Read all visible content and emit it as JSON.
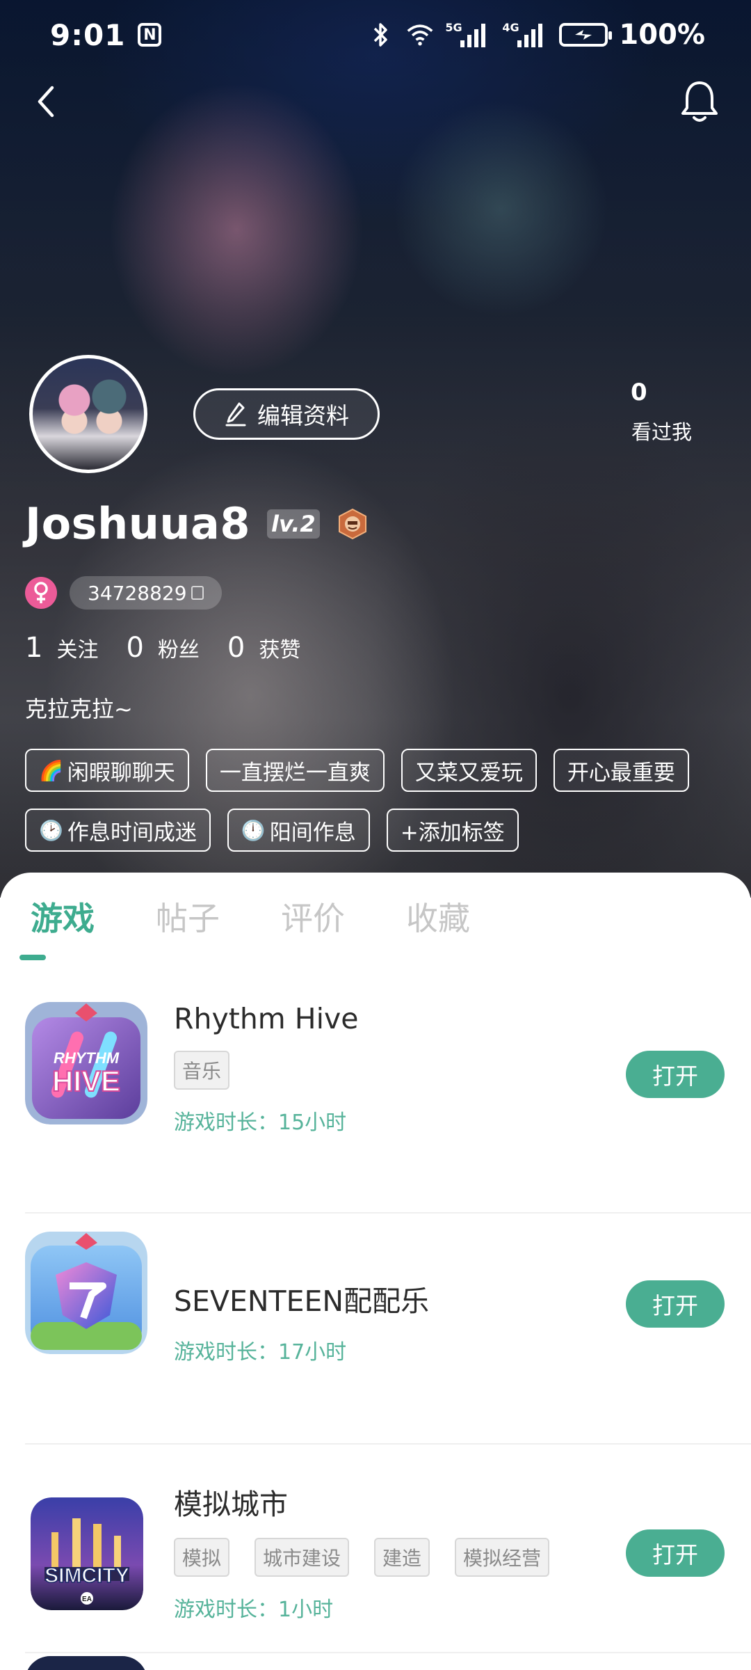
{
  "status_bar": {
    "time": "9:01",
    "nfc_label": "N",
    "network_5g": "5G",
    "network_4g": "4G",
    "battery_percent": "100%"
  },
  "profile": {
    "edit_label": "编辑资料",
    "viewers_count": "0",
    "viewers_label": "看过我",
    "username": "Joshuua8",
    "level": "lv.2",
    "user_id": "34728829",
    "stats": [
      {
        "value": "1",
        "label": "关注"
      },
      {
        "value": "0",
        "label": "粉丝"
      },
      {
        "value": "0",
        "label": "获赞"
      }
    ],
    "bio": "克拉克拉~",
    "tags": [
      {
        "emoji": "🌈",
        "text": "闲暇聊聊天"
      },
      {
        "emoji": "",
        "text": "一直摆烂一直爽"
      },
      {
        "emoji": "",
        "text": "又菜又爱玩"
      },
      {
        "emoji": "",
        "text": "开心最重要"
      },
      {
        "emoji": "🕑",
        "text": "作息时间成迷"
      },
      {
        "emoji": "🕛",
        "text": "阳间作息"
      },
      {
        "emoji": "",
        "text": "+添加标签"
      }
    ]
  },
  "tabs": [
    "游戏",
    "帖子",
    "评价",
    "收藏"
  ],
  "games": [
    {
      "title": "Rhythm Hive",
      "genres": [
        "音乐"
      ],
      "playtime": "游戏时长：15小时",
      "open_label": "打开",
      "icon_text": "RHYTHM HIVE"
    },
    {
      "title": "SEVENTEEN配配乐",
      "genres": [],
      "playtime": "游戏时长：17小时",
      "open_label": "打开",
      "icon_text": ""
    },
    {
      "title": "模拟城市",
      "genres": [
        "模拟",
        "城市建设",
        "建造",
        "模拟经营"
      ],
      "playtime": "游戏时长：1小时",
      "open_label": "打开",
      "icon_text": "SIMCITY"
    }
  ],
  "colors": {
    "accent": "#3eac8f",
    "button": "#4aae92",
    "playtime": "#56b39a",
    "gender_female": "#ec5b98"
  }
}
